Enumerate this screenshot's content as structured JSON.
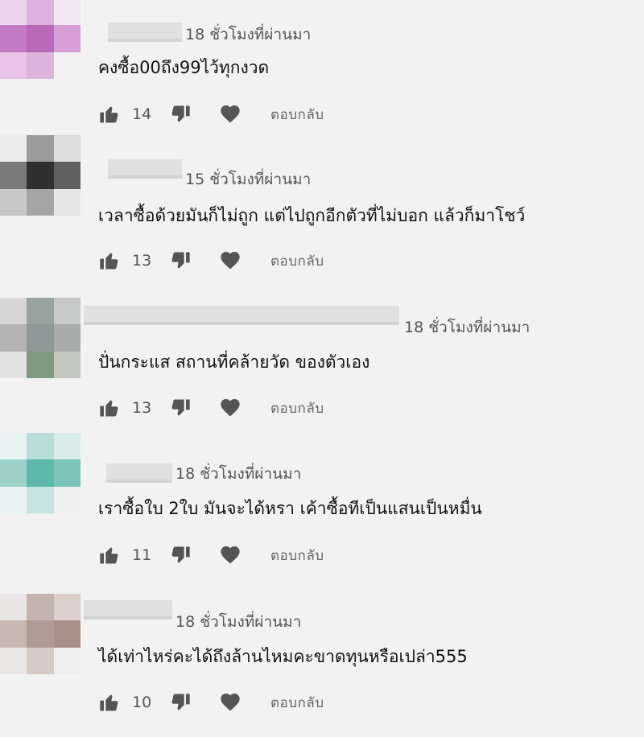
{
  "comments": [
    {
      "time": "18 ชั่วโมงที่ผ่านมา",
      "text": "คงซื้อ00ถึง99ไว้ทุกงวด",
      "likes": "14",
      "reply": "ตอบกลับ",
      "avatar_colors": [
        "#eed5ee",
        "#ddb0dd",
        "#f4e6f4",
        "#c37cc3",
        "#b86ab8",
        "#d79ed7",
        "#e8c4e8",
        "#dcb4dc",
        "#f2f2f2"
      ]
    },
    {
      "time": "15 ชั่วโมงที่ผ่านมา",
      "text": "เวลาซื้อด้วยมันก็ไม่ถูก แต่ไปถูกอีกตัวที่ไม่บอก แล้วก็มาโชว์",
      "likes": "13",
      "reply": "ตอบกลับ",
      "avatar_colors": [
        "#ececec",
        "#9b9b9b",
        "#dcdcdc",
        "#7a7a7a",
        "#2f2f2f",
        "#5f5f5f",
        "#c8c8c8",
        "#a5a5a5",
        "#e6e6e6"
      ]
    },
    {
      "time": "18 ชั่วโมงที่ผ่านมา",
      "text": "ปั่นกระแส สถานที่คล้ายวัด ของตัวเอง",
      "likes": "13",
      "reply": "ตอบกลับ",
      "avatar_colors": [
        "#d6d6d6",
        "#98a29e",
        "#c7cac8",
        "#b4b4b4",
        "#8e9896",
        "#a9acab",
        "#e2e2e2",
        "#7f9a80",
        "#c3c8c3"
      ]
    },
    {
      "time": "18 ชั่วโมงที่ผ่านมา",
      "text": "เราซื้อใบ 2ใบ มันจะได้หรา  เค้าซื้อทีเป็นแสนเป็นหมื่น",
      "likes": "11",
      "reply": "ตอบกลับ",
      "avatar_colors": [
        "#e8f2f1",
        "#b9ddd8",
        "#d9ecea",
        "#9cd0c9",
        "#5eb7ab",
        "#7cc5bb",
        "#e9f3f2",
        "#c8e4e0",
        "#f0f0f0"
      ]
    },
    {
      "time": "18 ชั่วโมงที่ผ่านมา",
      "text": "ได้เท่าไหร่คะได้ถึงล้านไหมคะขาดทุนหรือเปล่า555",
      "likes": "10",
      "reply": "ตอบกลับ",
      "avatar_colors": [
        "#e9e6e5",
        "#c4b3ae",
        "#ddd0cc",
        "#c9b7b2",
        "#b09a94",
        "#a89089",
        "#ebe7e6",
        "#d8cbc7",
        "#eeeeee"
      ]
    }
  ],
  "colors": {
    "icon": "#555555",
    "background": "#f2f2f2"
  },
  "icons": {
    "like": "thumbs-up-icon",
    "dislike": "thumbs-down-icon",
    "heart": "heart-icon"
  }
}
